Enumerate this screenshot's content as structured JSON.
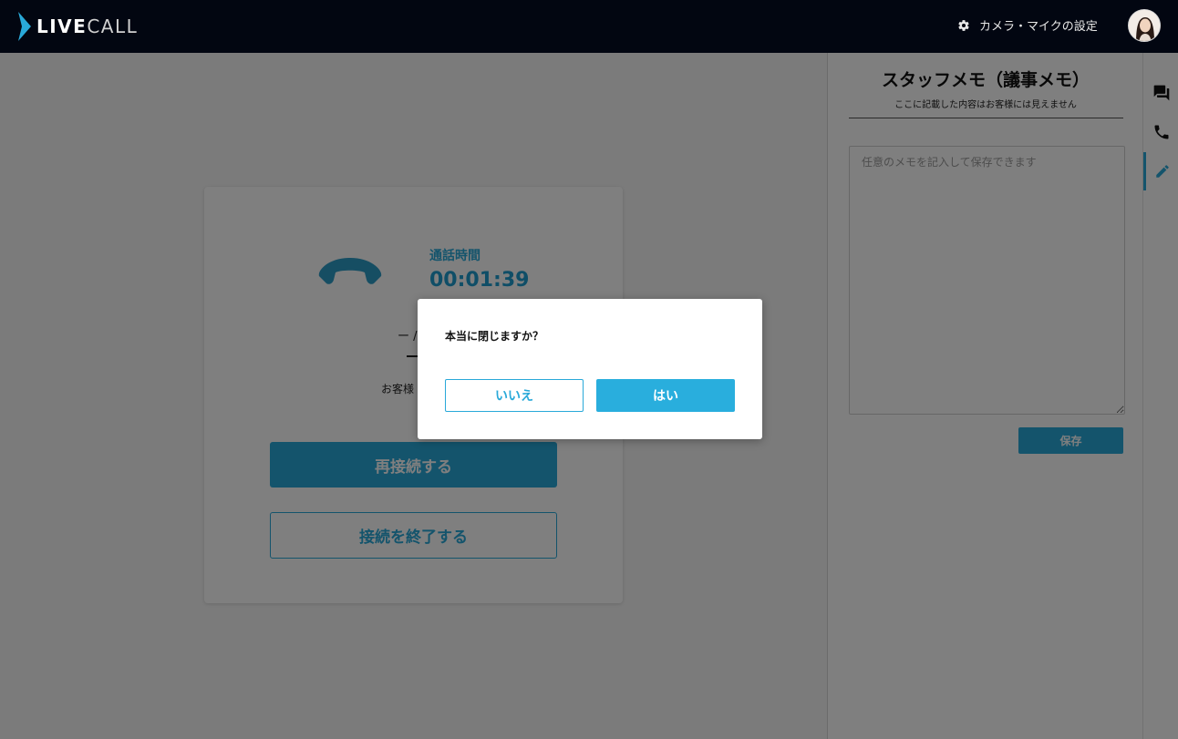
{
  "header": {
    "logo_live": "LIVE",
    "logo_call": "CALL",
    "camera_settings_label": "カメラ・マイクの設定"
  },
  "call": {
    "duration_label": "通話時間",
    "duration_value": "00:01:39",
    "status_text": "ー / ",
    "customer_text": "お客様",
    "reconnect_label": "再接続する",
    "end_label": "接続を終了する"
  },
  "memo": {
    "title": "スタッフメモ（議事メモ）",
    "subtitle": "ここに記載した内容はお客様には見えません",
    "placeholder": "任意のメモを記入して保存できます",
    "save_label": "保存"
  },
  "rail": {
    "items": [
      {
        "icon": "chat-icon",
        "active": false
      },
      {
        "icon": "phone-icon",
        "active": false
      },
      {
        "icon": "pencil-icon",
        "active": true
      }
    ]
  },
  "dialog": {
    "message": "本当に閉じますか？",
    "no_label": "いいえ",
    "yes_label": "はい"
  },
  "colors": {
    "accent": "#29a9d9",
    "header_bg": "#020611",
    "overlay": "rgba(0,0,0,0.5)"
  }
}
